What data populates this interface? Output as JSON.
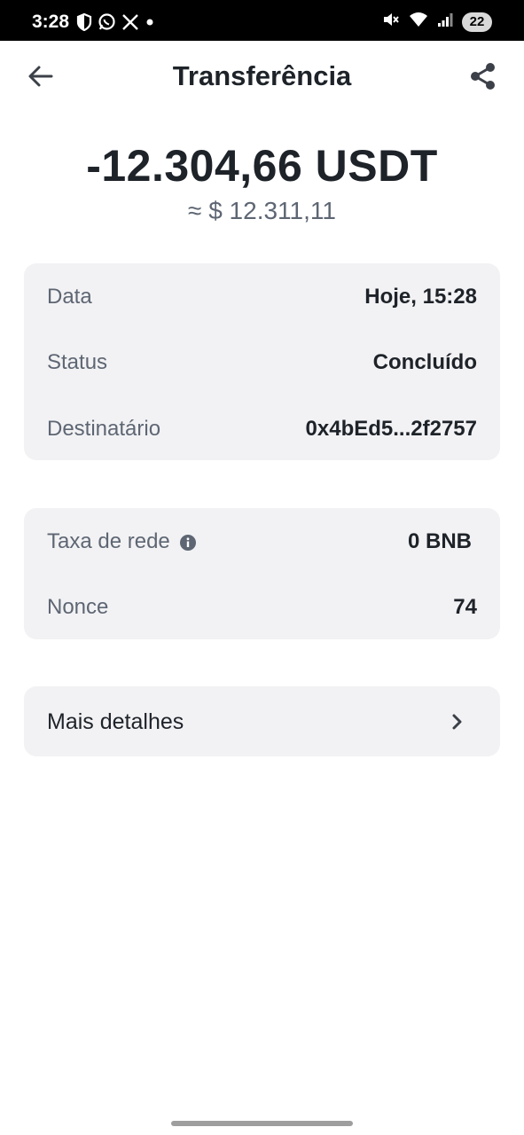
{
  "status_bar": {
    "time": "3:28",
    "battery": "22",
    "left_icons": [
      "shield-icon",
      "whatsapp-icon",
      "x-icon",
      "dot-icon"
    ],
    "right_icons": [
      "mute-icon",
      "wifi-icon",
      "signal-icon"
    ]
  },
  "header": {
    "title": "Transferência",
    "back_icon": "arrow-left-icon",
    "share_icon": "share-icon"
  },
  "amount": {
    "value": "-12.304,66 USDT",
    "fiat": "≈ $ 12.311,11"
  },
  "details": {
    "date_label": "Data",
    "date_value": "Hoje, 15:28",
    "status_label": "Status",
    "status_value": "Concluído",
    "recipient_label": "Destinatário",
    "recipient_value": "0x4bEd5...2f2757"
  },
  "fees": {
    "network_fee_label": "Taxa de rede",
    "network_fee_value": "0 BNB",
    "nonce_label": "Nonce",
    "nonce_value": "74"
  },
  "more": {
    "label": "Mais detalhes"
  },
  "colors": {
    "card_bg": "#f2f2f4",
    "text_primary": "#1e2329",
    "text_secondary": "#5e6673"
  }
}
